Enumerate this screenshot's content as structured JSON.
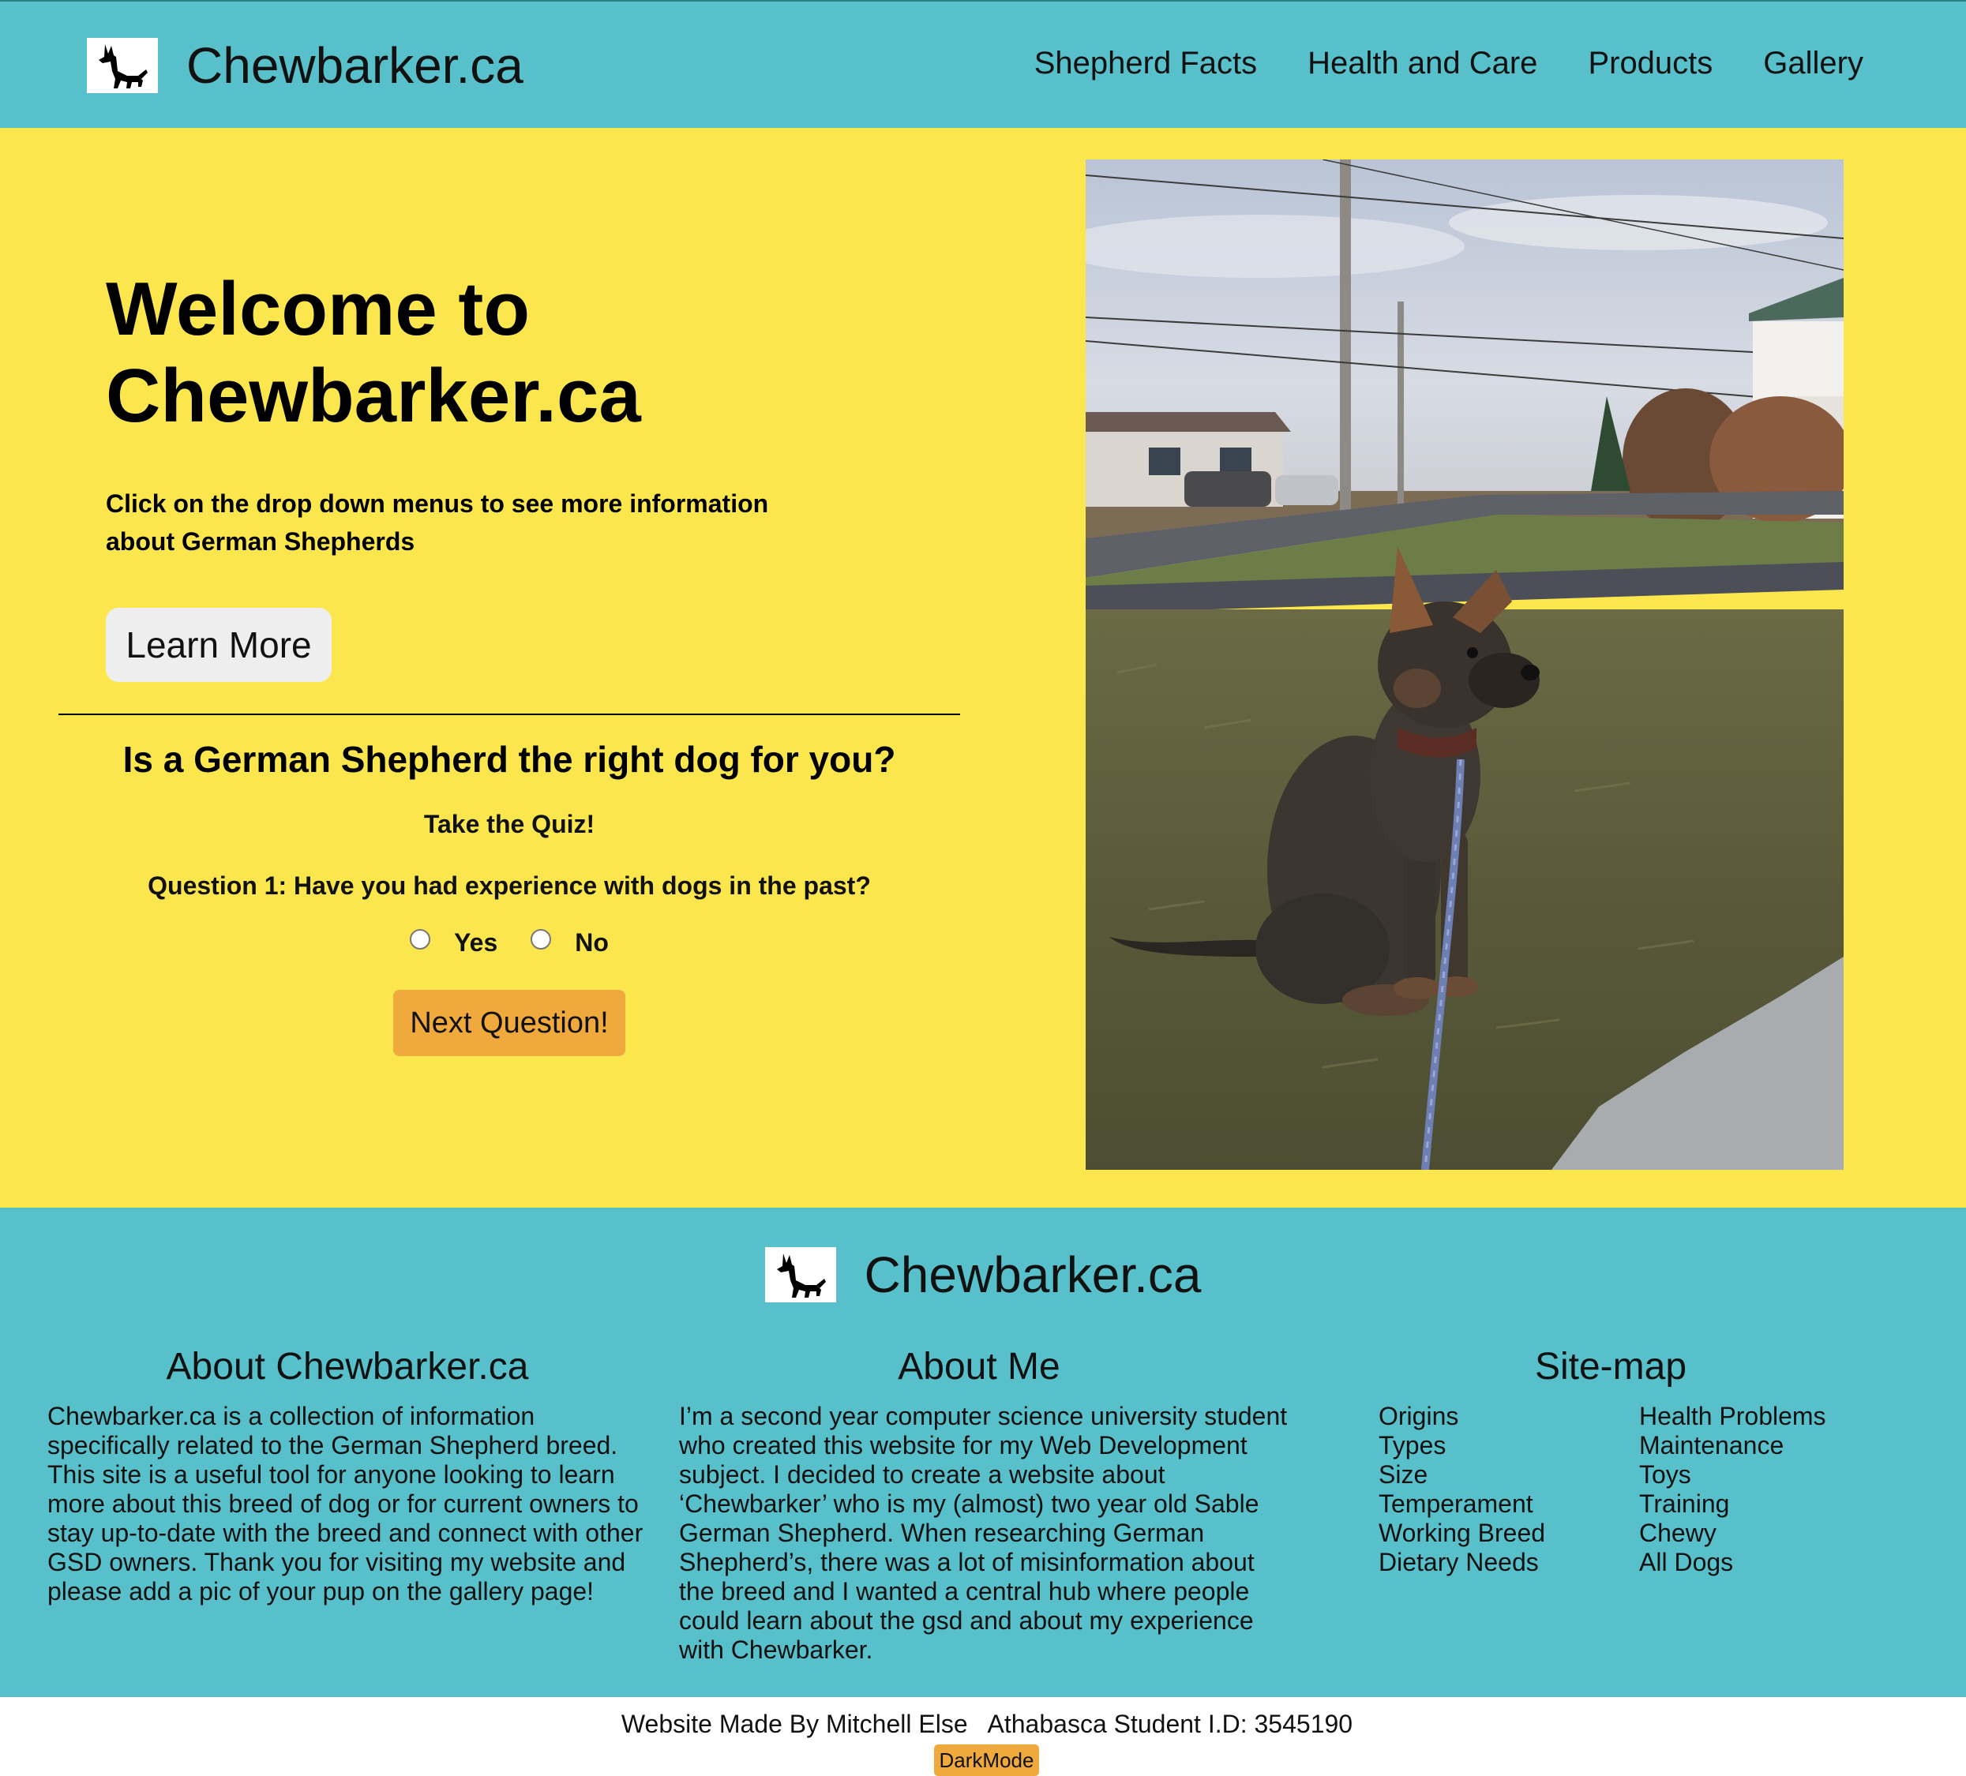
{
  "header": {
    "brand_name": "Chewbarker.ca",
    "logo_icon": "german-shepherd-silhouette-icon",
    "nav": [
      {
        "label": "Shepherd Facts"
      },
      {
        "label": "Health and Care"
      },
      {
        "label": "Products"
      },
      {
        "label": "Gallery"
      }
    ]
  },
  "hero": {
    "title": "Welcome to Chewbarker.ca",
    "subtitle": "Click on the drop down menus to see more information about German Shepherds",
    "learn_more_label": "Learn More",
    "photo_description": "German Shepherd puppy photo"
  },
  "quiz": {
    "title": "Is a German Shepherd the right dog for you?",
    "take_quiz": "Take the Quiz!",
    "question": "Question 1: Have you had experience with dogs in the past?",
    "options": [
      "Yes",
      "No"
    ],
    "next_label": "Next Question!"
  },
  "footer": {
    "brand_name": "Chewbarker.ca",
    "about_site": {
      "title": "About Chewbarker.ca",
      "text": "Chewbarker.ca is a collection of information specifically related to the German Shepherd breed. This site is a useful tool for anyone looking to learn more about this breed of dog or for current owners to stay up-to-date with the breed and connect with other GSD owners. Thank you for visiting my website and please add a pic of your pup on the gallery page!"
    },
    "about_me": {
      "title": "About Me",
      "text": "I’m a second year computer science university student who created this website for my Web Development subject. I decided to create a website about ‘Chewbarker’ who is my (almost) two year old Sable German Shepherd. When researching German Shepherd’s, there was a lot of misinformation about the breed and I wanted a central hub where people could learn about the gsd and about my experience with Chewbarker."
    },
    "sitemap": {
      "title": "Site-map",
      "col1": [
        "Origins",
        "Types",
        "Size",
        "Temperament",
        "Working Breed",
        "Dietary Needs"
      ],
      "col2": [
        "Health Problems",
        "Maintenance",
        "Toys",
        "Training",
        "Chewy",
        "All Dogs"
      ]
    }
  },
  "bottom": {
    "credits": "Website Made By Mitchell Else   Athabasca Student I.D: 3545190",
    "darkmode_label": "DarkMode"
  },
  "colors": {
    "header_bg": "#57c0ca",
    "hero_bg": "#fbe74d",
    "accent_button": "#f0a93c",
    "learn_button": "#eeeeee"
  }
}
